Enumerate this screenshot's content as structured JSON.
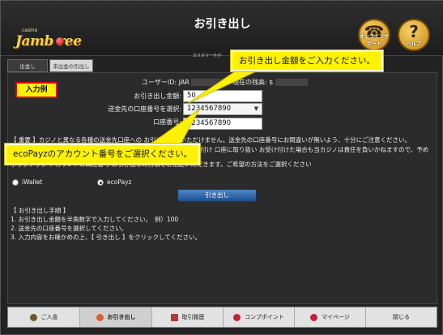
{
  "header": {
    "logo_small": "casino",
    "logo_text": "Jamb  ree",
    "title": "お引き出し",
    "support_label": "オンラインサポート",
    "help_label": "ヘルプ",
    "help_glyph": "?",
    "support_glyph": "☎",
    "customer_label": "カスタマーサポ-"
  },
  "subtabs": [
    {
      "label": "出金し"
    },
    {
      "label": "未出金の引出し"
    }
  ],
  "example_badge": "入力例",
  "form": {
    "user_id_label": "ユーザーID: JAR",
    "balance_label": "現在の残高: $",
    "amount_label": "お引き出し金額:",
    "amount_value": "50",
    "account_select_label": "送金先の口座番号を選択:",
    "account_select_value": "1234567890",
    "account_number_label": "口座番号:",
    "account_number_value": "1234567890"
  },
  "notice": {
    "line1": "【 重要 】カジノと異なる各種の送金先口座への お引き出しはいただけません。送金先の口座番号にお間違いが無いよう、十分にご注意ください。",
    "line2": "送金先口座番号の誤りにより、お客様の入金が確認できない場合 受け付け 口座に取り扱い  お受け付けた場合も当カジノは責任を負いかねますので、予めご了承ください。",
    "line3": "ポップアップ  アカウントの口座番号  お引き出しの方法をご指定いただきます。ご希望の方法をご選択ください"
  },
  "methods": [
    {
      "label": "iWallet",
      "checked": false
    },
    {
      "label": "ecoPayz",
      "checked": true
    }
  ],
  "submit_label": "引き出し",
  "steps": {
    "heading": "【 お引き出し手順 】",
    "step1": "1. お引き出し金額を半角数字で入力してください。　例）100",
    "step2": "2. 送金先の口座番号を選択してください。",
    "step3": "3. 入力内容をお確かめの上、【 引き出し 】をクリックしてください。"
  },
  "callouts": {
    "amount": "お引き出し金額をご入力ください。",
    "account": "ecoPayzのアカウント番号をご選択ください。"
  },
  "bottom_nav": [
    {
      "label": "ご入金",
      "icon": "deposit-icon",
      "color": "#6a5a2a"
    },
    {
      "label": "お引き出し",
      "icon": "withdraw-icon",
      "color": "#d9622a"
    },
    {
      "label": "取引履歴",
      "icon": "history-icon",
      "color": "#b23a3a"
    },
    {
      "label": "コンプポイント",
      "icon": "comp-points-icon",
      "color": "#c0203a"
    },
    {
      "label": "マイページ",
      "icon": "mypage-icon",
      "color": "#c0203a"
    },
    {
      "label": "閉じる",
      "icon": "",
      "color": ""
    }
  ],
  "colors": {
    "accent_yellow": "#fff200",
    "badge_border": "#e2001a",
    "submit_blue": "#1f4f8c"
  }
}
